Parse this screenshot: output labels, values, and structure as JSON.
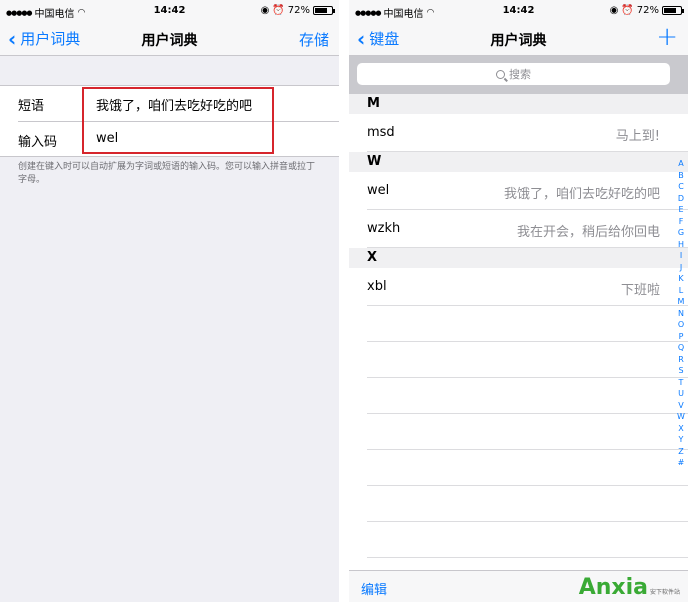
{
  "status": {
    "carrier": "中国电信",
    "time": "14:42",
    "battery": "72%",
    "battery_level": 0.72
  },
  "left": {
    "back_label": "用户词典",
    "title": "用户词典",
    "save_label": "存储",
    "phrase_label": "短语",
    "phrase_value": "我饿了，咱们去吃好吃的吧",
    "shortcut_label": "输入码",
    "shortcut_value": "wel",
    "footnote": "创建在键入时可以自动扩展为字词或短语的输入码。您可以输入拼音或拉丁字母。"
  },
  "right": {
    "back_label": "键盘",
    "title": "用户词典",
    "add_label": "+",
    "search_placeholder": "搜索",
    "sections": [
      {
        "letter": "M",
        "rows": [
          {
            "key": "msd",
            "phrase": "马上到!"
          }
        ]
      },
      {
        "letter": "W",
        "rows": [
          {
            "key": "wel",
            "phrase": "我饿了，咱们去吃好吃的吧"
          },
          {
            "key": "wzkh",
            "phrase": "我在开会，稍后给你回电"
          }
        ]
      },
      {
        "letter": "X",
        "rows": [
          {
            "key": "xbl",
            "phrase": "下班啦"
          }
        ]
      }
    ],
    "index": [
      "A",
      "B",
      "C",
      "D",
      "E",
      "F",
      "G",
      "H",
      "I",
      "J",
      "K",
      "L",
      "M",
      "N",
      "O",
      "P",
      "Q",
      "R",
      "S",
      "T",
      "U",
      "V",
      "W",
      "X",
      "Y",
      "Z",
      "#"
    ],
    "edit_label": "编辑"
  },
  "watermark": {
    "main": "Anxia",
    "sub": "安下软件站"
  },
  "colors": {
    "accent": "#0a7aff",
    "highlight": "#d6252c",
    "watermark": "#3aaa35"
  }
}
